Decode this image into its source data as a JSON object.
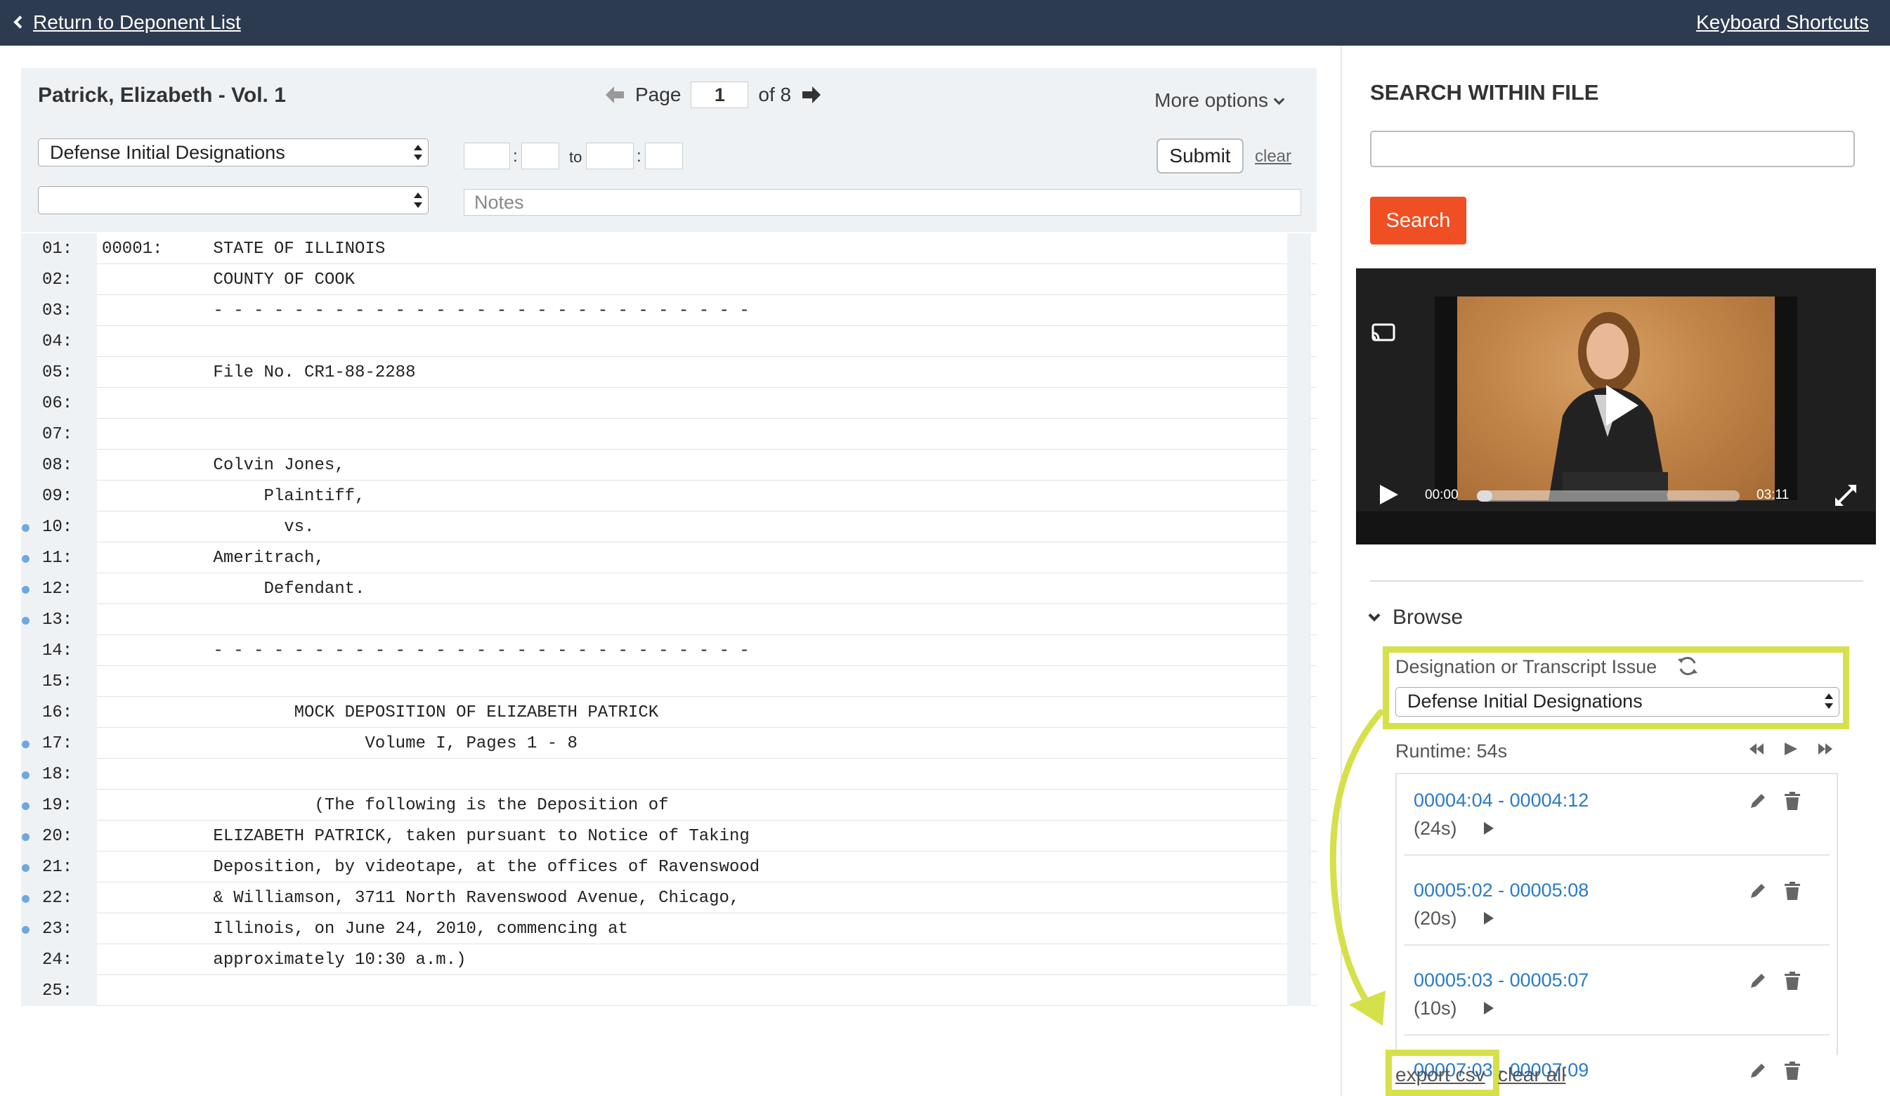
{
  "topbar": {
    "back_label": "Return to Deponent List",
    "shortcuts_label": "Keyboard Shortcuts",
    "bg_color": "#2c3b4f"
  },
  "toolbar": {
    "deponent": "Patrick, Elizabeth - Vol. 1",
    "page_label": "Page",
    "page_value": "1",
    "page_total": "of 8",
    "more_options": "More options",
    "designation_select": "Defense Initial Designations",
    "issue_select": "",
    "to_label": "to",
    "time_sep": ":",
    "submit": "Submit",
    "clear": "clear",
    "notes_placeholder": "Notes"
  },
  "transcript": {
    "lines": [
      {
        "num": "01:",
        "text": "00001:     STATE OF ILLINOIS",
        "mark": false
      },
      {
        "num": "02:",
        "text": "           COUNTY OF COOK",
        "mark": false
      },
      {
        "num": "03:",
        "text": "           - - - - - - - - - - - - - - - - - - - - - - - - - - -",
        "mark": false
      },
      {
        "num": "04:",
        "text": "",
        "mark": false
      },
      {
        "num": "05:",
        "text": "           File No. CR1-88-2288",
        "mark": false
      },
      {
        "num": "06:",
        "text": "",
        "mark": false
      },
      {
        "num": "07:",
        "text": "",
        "mark": false
      },
      {
        "num": "08:",
        "text": "           Colvin Jones,",
        "mark": false
      },
      {
        "num": "09:",
        "text": "                Plaintiff,",
        "mark": false
      },
      {
        "num": "10:",
        "text": "                  vs.",
        "mark": true
      },
      {
        "num": "11:",
        "text": "           Ameritrach,",
        "mark": true
      },
      {
        "num": "12:",
        "text": "                Defendant.",
        "mark": true
      },
      {
        "num": "13:",
        "text": "",
        "mark": true
      },
      {
        "num": "14:",
        "text": "           - - - - - - - - - - - - - - - - - - - - - - - - - - -",
        "mark": false
      },
      {
        "num": "15:",
        "text": "",
        "mark": false
      },
      {
        "num": "16:",
        "text": "                   MOCK DEPOSITION OF ELIZABETH PATRICK",
        "mark": false
      },
      {
        "num": "17:",
        "text": "                          Volume I, Pages 1 - 8",
        "mark": true
      },
      {
        "num": "18:",
        "text": "",
        "mark": true
      },
      {
        "num": "19:",
        "text": "                     (The following is the Deposition of",
        "mark": true
      },
      {
        "num": "20:",
        "text": "           ELIZABETH PATRICK, taken pursuant to Notice of Taking",
        "mark": true
      },
      {
        "num": "21:",
        "text": "           Deposition, by videotape, at the offices of Ravenswood",
        "mark": true
      },
      {
        "num": "22:",
        "text": "           & Williamson, 3711 North Ravenswood Avenue, Chicago,",
        "mark": true
      },
      {
        "num": "23:",
        "text": "           Illinois, on June 24, 2010, commencing at",
        "mark": true
      },
      {
        "num": "24:",
        "text": "           approximately 10:30 a.m.)",
        "mark": false
      },
      {
        "num": "25:",
        "text": "",
        "mark": false
      }
    ]
  },
  "search": {
    "title": "SEARCH WITHIN FILE",
    "input_value": "",
    "button": "Search",
    "button_color": "#f04e23"
  },
  "video": {
    "current_time": "00:00",
    "duration": "03:11",
    "progress": 0
  },
  "browse": {
    "label": "Browse",
    "designation_label": "Designation or Transcript Issue",
    "designation_value": "Defense Initial Designations",
    "runtime": "Runtime: 54s",
    "clips": [
      {
        "range": "00004:04 - 00004:12",
        "duration": "(24s)"
      },
      {
        "range": "00005:02 - 00005:08",
        "duration": "(20s)"
      },
      {
        "range": "00005:03 - 00005:07",
        "duration": "(10s)"
      },
      {
        "range": "00007:03 - 00007:09",
        "duration": ""
      }
    ],
    "export_csv": "export csv",
    "clear_all": "clear all",
    "highlight_color": "#d6e04a",
    "link_color": "#2a7cc7"
  }
}
